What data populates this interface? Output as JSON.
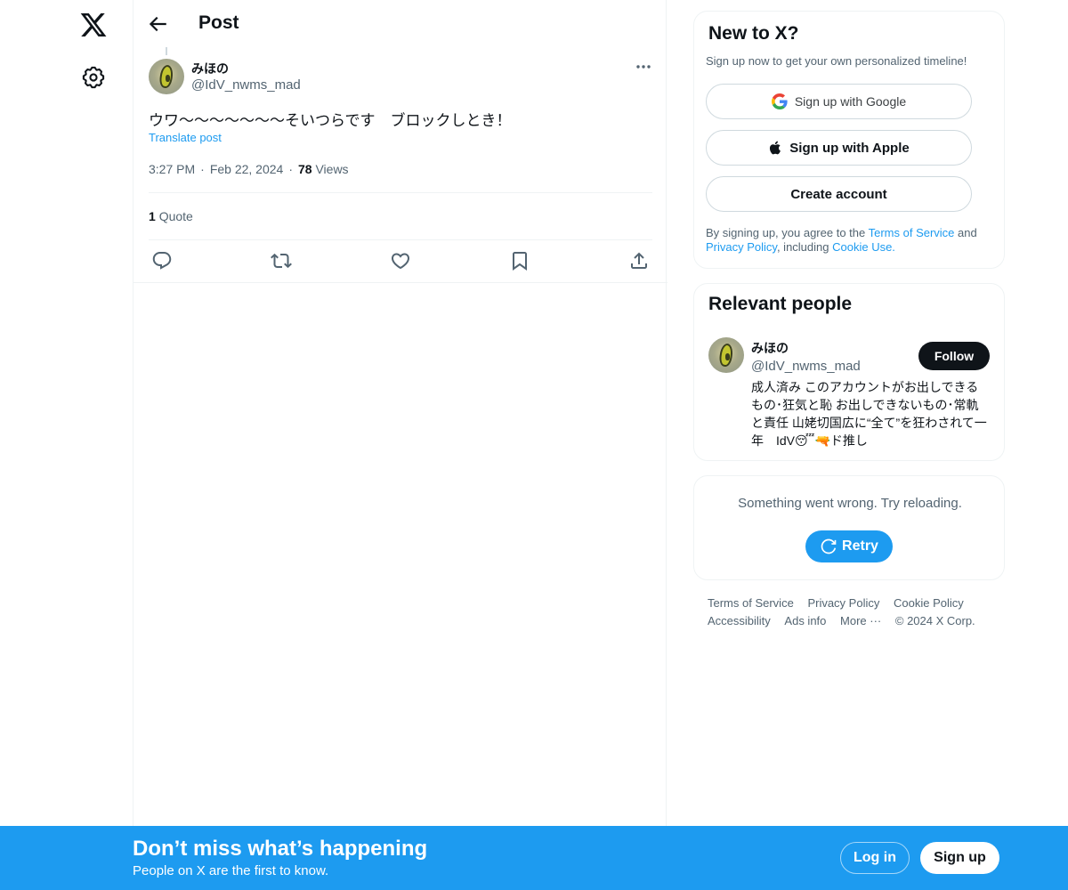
{
  "nav": {
    "logo_icon": "x-logo-icon",
    "settings_icon": "gear-icon"
  },
  "header": {
    "back_icon": "arrow-left-icon",
    "title": "Post"
  },
  "post": {
    "author_name": "みほの",
    "author_handle": "@IdV_nwms_mad",
    "text": "ウワ〜〜〜〜〜〜〜そいつらです　ブロックしとき！",
    "translate_label": "Translate post",
    "time": "3:27 PM",
    "date": "Feb 22, 2024",
    "separator": "·",
    "views_count": "78",
    "views_label": "Views",
    "quote_count": "1",
    "quote_label": "Quote",
    "actions": [
      "reply-icon",
      "repost-icon",
      "like-icon",
      "bookmark-icon",
      "share-icon"
    ]
  },
  "signup_card": {
    "title": "New to X?",
    "subtitle": "Sign up now to get your own personalized timeline!",
    "google_label": "Sign up with Google",
    "apple_label": "Sign up with Apple",
    "create_label": "Create account",
    "legal_prefix": "By signing up, you agree to the ",
    "terms_link": "Terms of Service",
    "legal_and": " and ",
    "privacy_link": "Privacy Policy",
    "legal_including": ", including ",
    "cookie_link": "Cookie Use."
  },
  "relevant_people": {
    "title": "Relevant people",
    "name": "みほの",
    "handle": "@IdV_nwms_mad",
    "follow_label": "Follow",
    "bio": "成人済み このアカウントがお出しできるもの･狂気と恥 お出しできないもの･常軌と責任 山姥切国広に“全て”を狂わされて一年　IdV😴🔫ド推し"
  },
  "error_card": {
    "message": "Something went wrong. Try reloading.",
    "retry_label": "Retry"
  },
  "footer": {
    "links": [
      "Terms of Service",
      "Privacy Policy",
      "Cookie Policy",
      "Accessibility",
      "Ads info",
      "More ···"
    ],
    "copyright": "© 2024 X Corp."
  },
  "banner": {
    "title": "Don’t miss what’s happening",
    "subtitle": "People on X are the first to know.",
    "login_label": "Log in",
    "signup_label": "Sign up"
  },
  "colors": {
    "accent": "#1d9bf0",
    "text_primary": "#0f1419",
    "text_secondary": "#536471",
    "border": "#eff3f4"
  }
}
